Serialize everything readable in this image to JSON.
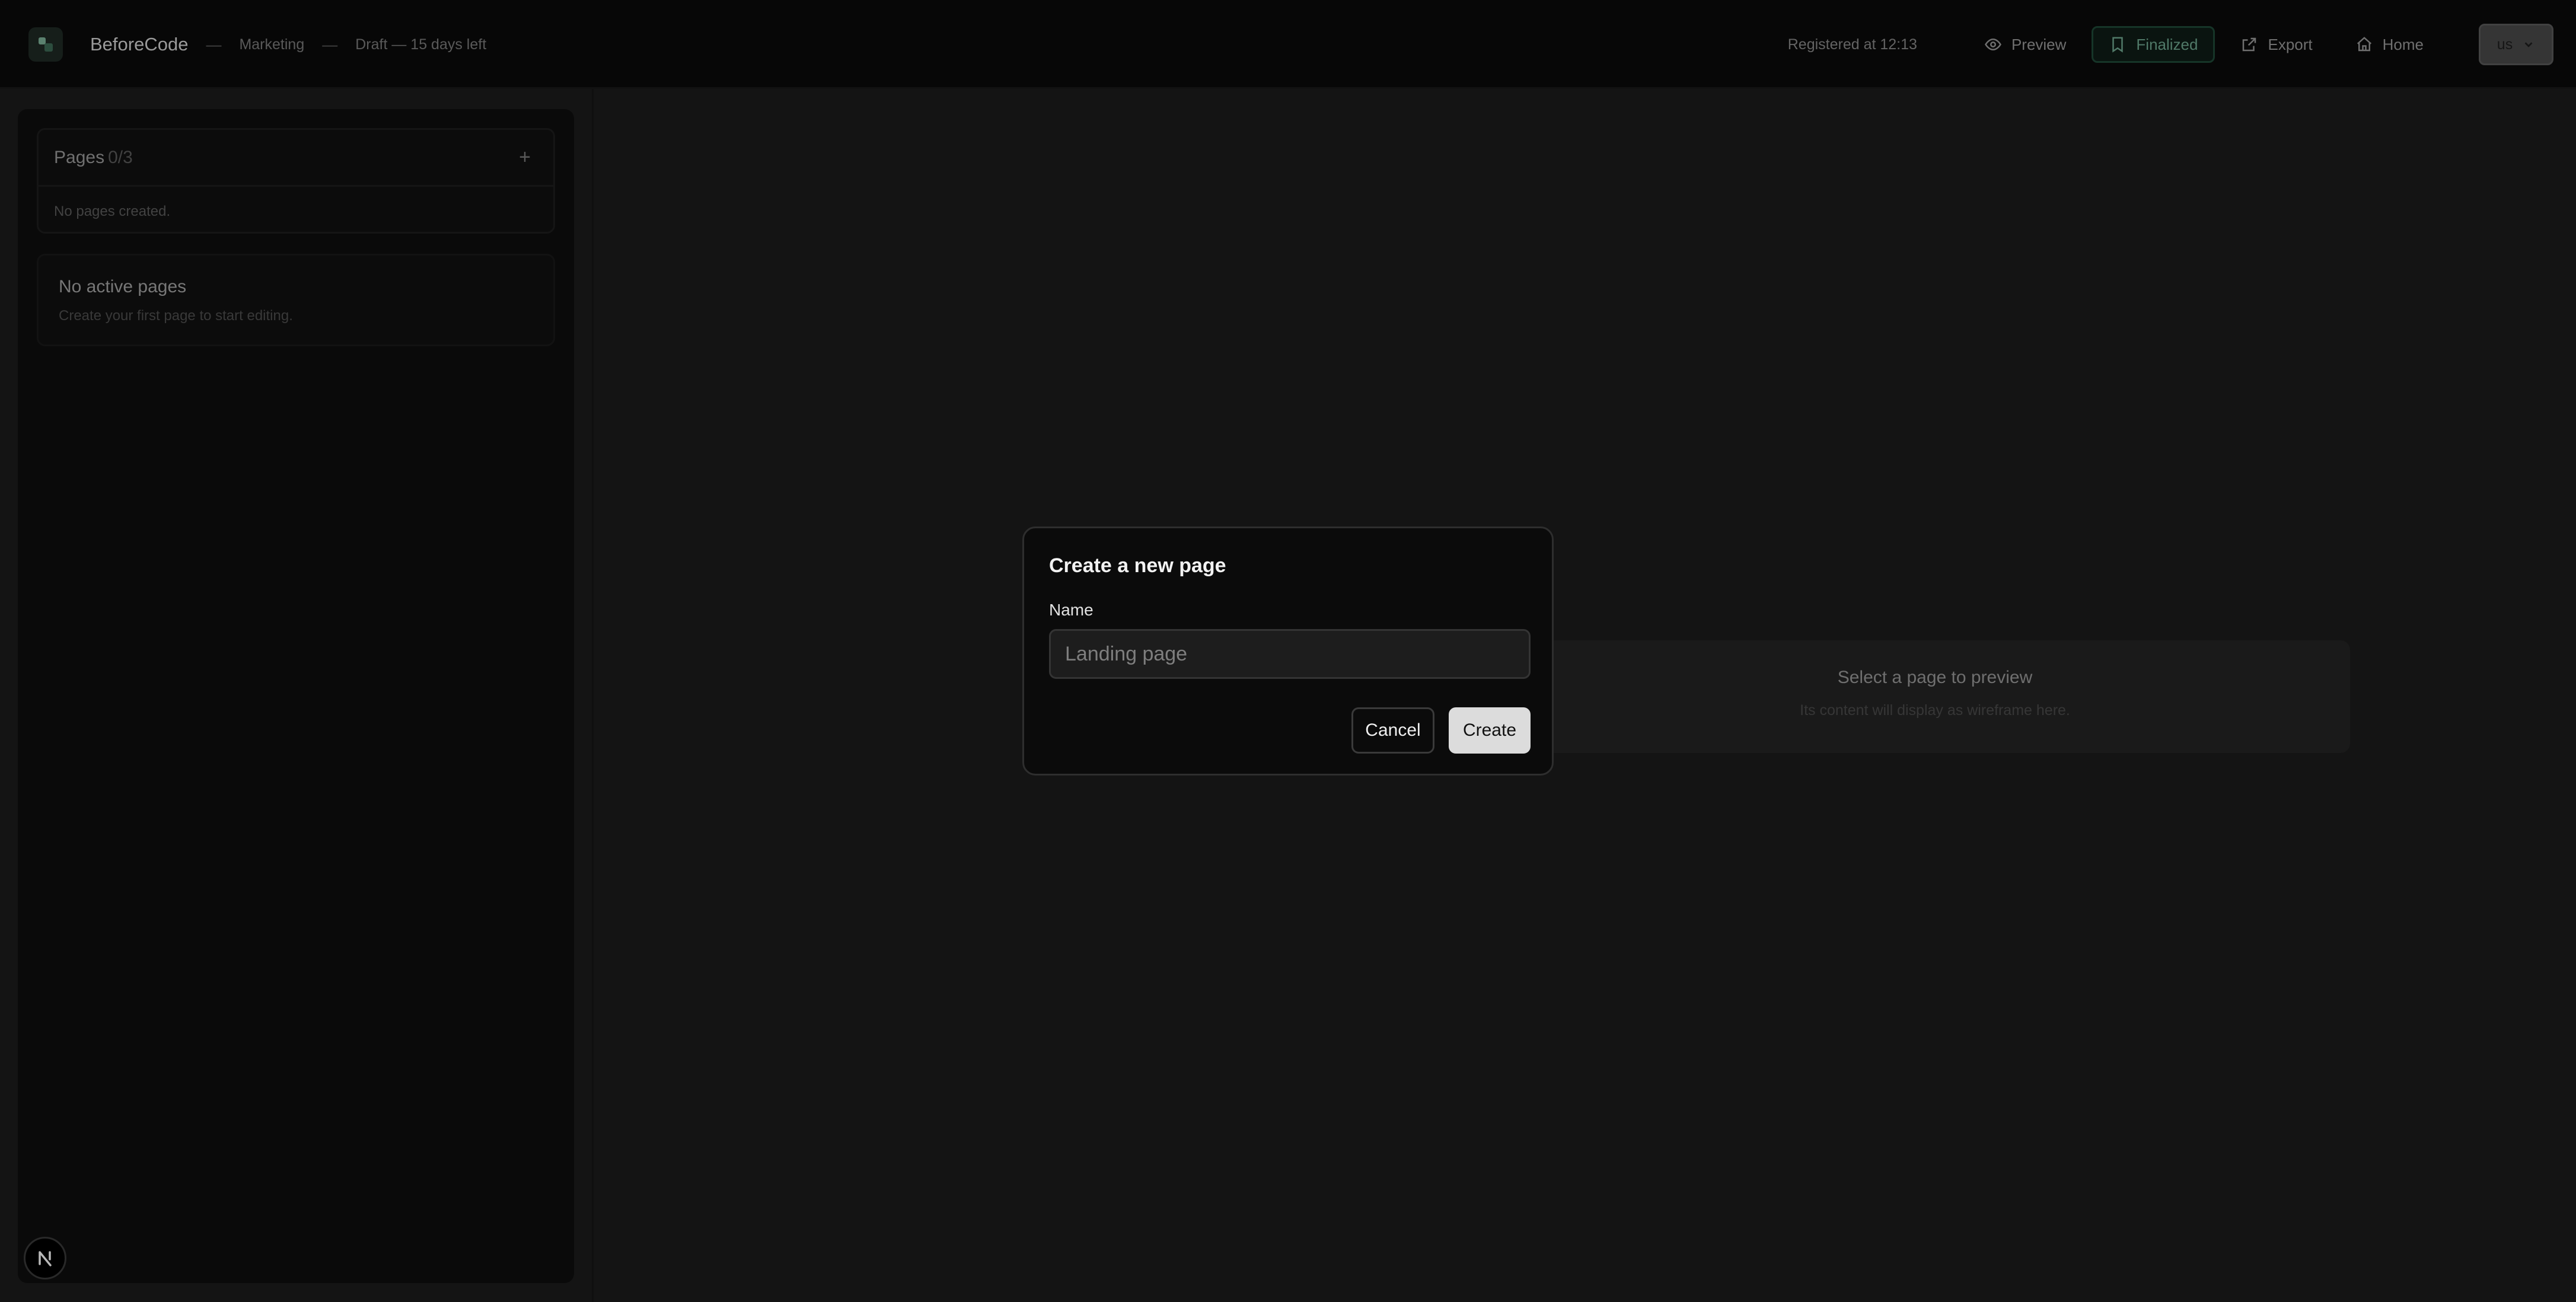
{
  "header": {
    "app_name": "BeforeCode",
    "separator": "—",
    "project": "Marketing",
    "status": "Draft — 15 days left",
    "registered": "Registered at 12:13",
    "buttons": {
      "preview": "Preview",
      "finalized": "Finalized",
      "export": "Export",
      "home": "Home"
    },
    "language": "us"
  },
  "sidebar": {
    "pages_title": "Pages",
    "pages_count": "0/3",
    "add_symbol": "+",
    "pages_empty": "No pages created.",
    "no_active_title": "No active pages",
    "no_active_sub": "Create your first page to start editing."
  },
  "main": {
    "preview_title": "Select a page to preview",
    "preview_sub": "Its content will display as wireframe here."
  },
  "modal": {
    "title": "Create a new page",
    "name_label": "Name",
    "name_placeholder": "Landing page",
    "name_value": "",
    "cancel": "Cancel",
    "create": "Create"
  },
  "colors": {
    "accent": "#6fa890",
    "background": "#1c1c1c",
    "header": "#0b0b0b"
  }
}
